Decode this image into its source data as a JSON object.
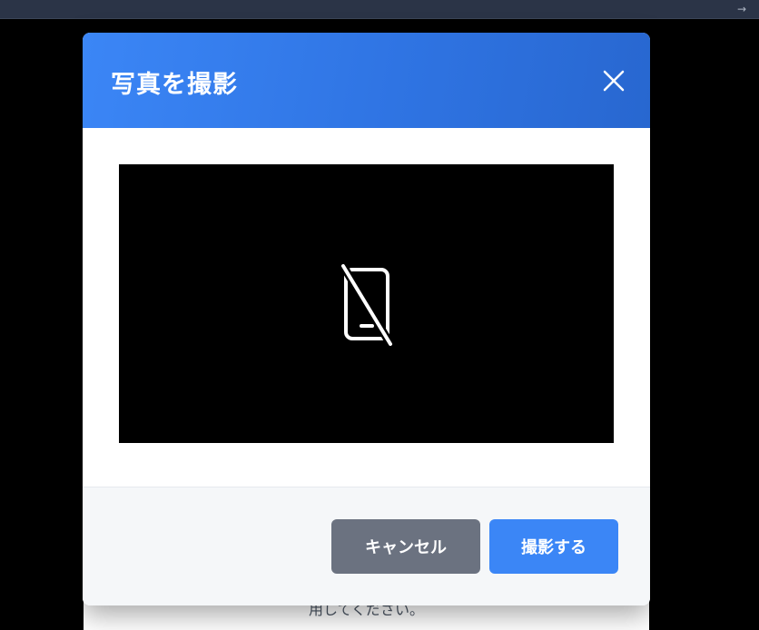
{
  "topbar": {
    "arrow_glyph": "→"
  },
  "background": {
    "partial_text": "用してください。"
  },
  "modal": {
    "title": "写真を撮影",
    "close_icon": "close-icon",
    "camera_status_icon": "camera-off-icon"
  },
  "footer": {
    "cancel_label": "キャンセル",
    "capture_label": "撮影する"
  },
  "colors": {
    "header_gradient_start": "#3b86f6",
    "header_gradient_end": "#2867d0",
    "cancel_button": "#6b7280",
    "capture_button": "#3b86f6",
    "footer_bg": "#f5f7f9"
  }
}
